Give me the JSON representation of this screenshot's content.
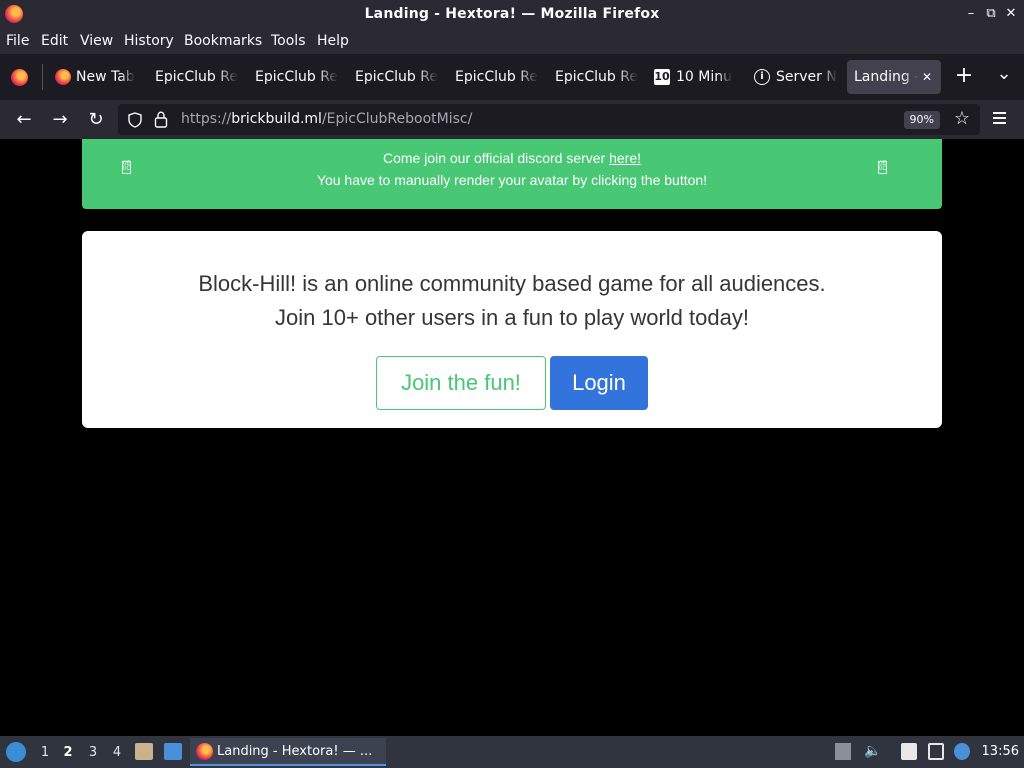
{
  "window": {
    "title": "Landing - Hextora! — Mozilla Firefox",
    "controls": {
      "minimize": "–",
      "restore": "⧉",
      "close": "✕"
    }
  },
  "menubar": {
    "items": [
      "File",
      "Edit",
      "View",
      "History",
      "Bookmarks",
      "Tools",
      "Help"
    ]
  },
  "tabs": [
    {
      "label": "New Tab",
      "icon": "firefox-icon"
    },
    {
      "label": "EpicClub Re",
      "icon": "none"
    },
    {
      "label": "EpicClub Re",
      "icon": "none"
    },
    {
      "label": "EpicClub Re",
      "icon": "none"
    },
    {
      "label": "EpicClub Re",
      "icon": "none"
    },
    {
      "label": "EpicClub Re",
      "icon": "none"
    },
    {
      "label": "10 Minu",
      "icon": "10-icon"
    },
    {
      "label": "Server N",
      "icon": "info-icon"
    },
    {
      "label": "Landing -",
      "icon": "none",
      "active": true
    }
  ],
  "tabstrip": {
    "new_tab": "+",
    "list_all": "⌄",
    "close_tab": "✕"
  },
  "navbar": {
    "url_scheme": "https://",
    "url_host": "brickbuild.ml",
    "url_path": "/EpicClubRebootMisc/",
    "zoom": "90%"
  },
  "alert": {
    "line1_prefix": "Come join our official discord server ",
    "line1_link": "here!",
    "line2": "You have to manually render your avatar by clicking the button!",
    "glyph": "0E 0C",
    "color": "#48c774"
  },
  "hero": {
    "tagline1": "Block-Hill! is an online community based game for all audiences.",
    "tagline2": "Join 10+ other users in a fun to play world today!",
    "join_label": "Join the fun!",
    "login_label": "Login",
    "primary_color": "#3273dc",
    "success_color": "#48c774"
  },
  "taskbar": {
    "workspaces": [
      "1",
      "2",
      "3",
      "4"
    ],
    "active_workspace": "2",
    "task_label": "Landing - Hextora! — ...",
    "clock": "13:56"
  }
}
